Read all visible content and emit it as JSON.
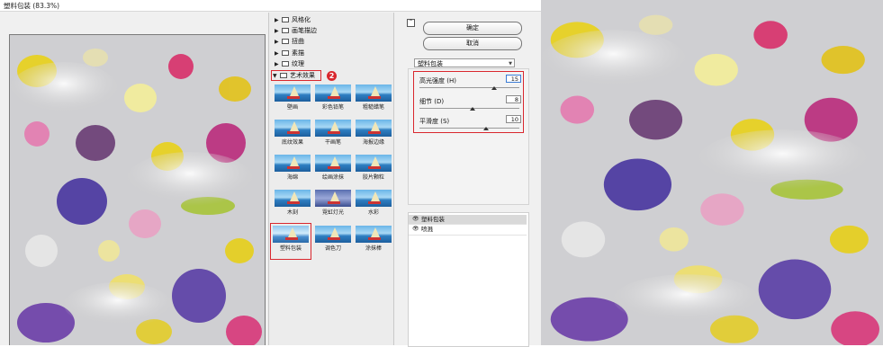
{
  "window": {
    "title": "塑料包装 (83.3%)"
  },
  "gallery": {
    "folders": [
      {
        "label": "风格化",
        "expanded": false
      },
      {
        "label": "画笔描边",
        "expanded": false
      },
      {
        "label": "扭曲",
        "expanded": false
      },
      {
        "label": "素描",
        "expanded": false
      },
      {
        "label": "纹理",
        "expanded": false
      },
      {
        "label": "艺术效果",
        "expanded": true
      }
    ],
    "step_badge": "2",
    "filters": [
      {
        "label": "壁画"
      },
      {
        "label": "彩色铅笔"
      },
      {
        "label": "粗糙蜡笔"
      },
      {
        "label": "底纹效果"
      },
      {
        "label": "干画笔"
      },
      {
        "label": "海报边缘"
      },
      {
        "label": "海绵"
      },
      {
        "label": "绘画涂抹"
      },
      {
        "label": "胶片颗粒"
      },
      {
        "label": "木刻"
      },
      {
        "label": "霓虹灯光"
      },
      {
        "label": "水彩"
      },
      {
        "label": "塑料包装"
      },
      {
        "label": "调色刀"
      },
      {
        "label": "涂抹棒"
      }
    ],
    "selected_filter": "塑料包装"
  },
  "options": {
    "ok_label": "确定",
    "cancel_label": "取消",
    "selected_filter": "塑料包装",
    "params": [
      {
        "label": "高光强度 (H)",
        "value": "15",
        "slider_fraction": 0.75
      },
      {
        "label": "细节 (D)",
        "value": "8",
        "slider_fraction": 0.53
      },
      {
        "label": "平滑度 (S)",
        "value": "10",
        "slider_fraction": 0.67
      }
    ]
  },
  "layers": {
    "items": [
      {
        "label": "塑料包装",
        "selected": true
      },
      {
        "label": "喷溅",
        "selected": false
      }
    ]
  },
  "colors": {
    "highlight_red": "#d9272e",
    "panel_bg": "#f0f0f0"
  }
}
